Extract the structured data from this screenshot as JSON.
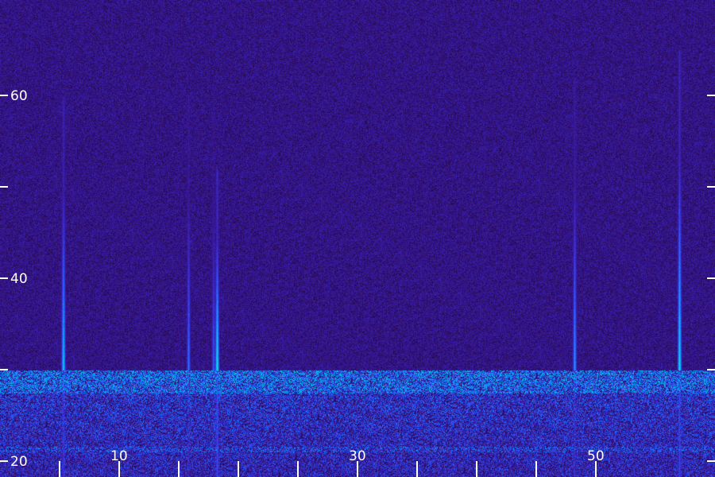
{
  "chart_data": {
    "type": "heatmap",
    "title": "",
    "xlabel": "",
    "ylabel": "",
    "xlim": [
      5,
      54
    ],
    "ylim": [
      20,
      66
    ],
    "x_ticks": [
      {
        "value": 5,
        "label": ""
      },
      {
        "value": 10,
        "label": "10"
      },
      {
        "value": 15,
        "label": ""
      },
      {
        "value": 20,
        "label": ""
      },
      {
        "value": 25,
        "label": ""
      },
      {
        "value": 30,
        "label": "30"
      },
      {
        "value": 35,
        "label": ""
      },
      {
        "value": 40,
        "label": ""
      },
      {
        "value": 45,
        "label": ""
      },
      {
        "value": 50,
        "label": "50"
      }
    ],
    "y_ticks": [
      {
        "value": 20,
        "label": "20"
      },
      {
        "value": 30,
        "label": ""
      },
      {
        "value": 40,
        "label": "40"
      },
      {
        "value": 50,
        "label": ""
      },
      {
        "value": 60,
        "label": "60"
      }
    ],
    "vertical_streaks": [
      {
        "x": 5.3,
        "y_from": 30,
        "y_to": 60,
        "peak": 0.85
      },
      {
        "x": 15.8,
        "y_from": 30,
        "y_to": 60,
        "peak": 0.6
      },
      {
        "x": 18.2,
        "y_from": 30,
        "y_to": 52,
        "peak": 0.95
      },
      {
        "x": 17.9,
        "y_from": 30,
        "y_to": 58,
        "peak": 0.55
      },
      {
        "x": 48.2,
        "y_from": 30,
        "y_to": 62,
        "peak": 0.7
      },
      {
        "x": 57.0,
        "y_from": 30,
        "y_to": 65,
        "peak": 0.9
      }
    ],
    "noise_floor_band": {
      "y_from": 20,
      "y_to": 30,
      "peak": 0.85
    },
    "colormap": [
      "#1a0a33",
      "#34107a",
      "#3a2ad0",
      "#1f6bff",
      "#00c8e8",
      "#29e88a"
    ]
  }
}
